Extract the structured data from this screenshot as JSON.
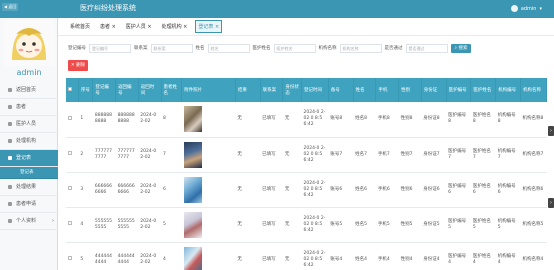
{
  "header": {
    "back_label": "◀ 返回",
    "title": "医疗纠纷处理系统",
    "admin_label": "admin"
  },
  "sidebar": {
    "username": "admin",
    "menu": [
      {
        "label": "返回首页"
      },
      {
        "label": "患者"
      },
      {
        "label": "医护人员"
      },
      {
        "label": "处理机构"
      },
      {
        "label": "登记表"
      },
      {
        "label": "处理结果"
      },
      {
        "label": "患者申请"
      },
      {
        "label": "个人资料"
      }
    ],
    "submenu_label": "登记表"
  },
  "tabs": [
    {
      "label": "系统首页"
    },
    {
      "label": "患者 ×"
    },
    {
      "label": "医护人员 ×"
    },
    {
      "label": "处理机构 ×"
    },
    {
      "label": "登记表 ×"
    }
  ],
  "filters": {
    "f1_label": "登记编号",
    "f1_placeholder": "登记编号",
    "f2_label": "联系案",
    "f2_placeholder": "联系案",
    "f3_label": "姓名",
    "f3_placeholder": "姓名",
    "f4_label": "医护姓名",
    "f4_placeholder": "医护姓名",
    "f5_label": "机构名称",
    "f5_placeholder": "机构名称",
    "f6_label": "是否通过",
    "f6_placeholder": "是否通过",
    "search_label": "搜索"
  },
  "delete_label": "删除",
  "table": {
    "headers": [
      "序号",
      "登记编号",
      "返回编号",
      "返回时间",
      "患者姓名",
      "附件照片",
      "结果",
      "联系案",
      "身份状态",
      "登记时间",
      "备号",
      "姓名",
      "手机",
      "性别",
      "身份证",
      "医护编号",
      "医护姓名",
      "机构编号",
      "机构名称"
    ],
    "rows": [
      {
        "idx": "1",
        "reg_no": "888888 8888",
        "ret_no": "888888 8888",
        "ret_time": "2024-0 2-02",
        "p_name": "8",
        "result": "无",
        "contact": "已填写",
        "status": "无",
        "reg_time": "2024-0 2-02 0 8:56:42",
        "num": "账号8",
        "name": "姓名8",
        "phone": "手机8",
        "gender": "性别8",
        "idcard": "身份证8",
        "d_no": "医护编号8",
        "d_name": "医护姓名8",
        "o_no": "机构编号8",
        "o_name": "机构名称8"
      },
      {
        "idx": "2",
        "reg_no": "777777 7777",
        "ret_no": "777777 7777",
        "ret_time": "2024-0 2-02",
        "p_name": "7",
        "result": "无",
        "contact": "已填写",
        "status": "无",
        "reg_time": "2024-0 2-02 0 8:56:42",
        "num": "账号7",
        "name": "姓名7",
        "phone": "手机7",
        "gender": "性别7",
        "idcard": "身份证7",
        "d_no": "医护编号7",
        "d_name": "医护姓名7",
        "o_no": "机构编号7",
        "o_name": "机构名称7"
      },
      {
        "idx": "3",
        "reg_no": "666666 6666",
        "ret_no": "666666 6666",
        "ret_time": "2024-0 2-02",
        "p_name": "6",
        "result": "无",
        "contact": "已填写",
        "status": "无",
        "reg_time": "2024-0 2-02 0 8:56:42",
        "num": "账号6",
        "name": "姓名6",
        "phone": "手机6",
        "gender": "性别6",
        "idcard": "身份证6",
        "d_no": "医护编号6",
        "d_name": "医护姓名6",
        "o_no": "机构编号6",
        "o_name": "机构名称6"
      },
      {
        "idx": "4",
        "reg_no": "555555 5555",
        "ret_no": "555555 5555",
        "ret_time": "2024-0 2-02",
        "p_name": "5",
        "result": "无",
        "contact": "已填写",
        "status": "无",
        "reg_time": "2024-0 2-02 0 8:56:42",
        "num": "账号5",
        "name": "姓名5",
        "phone": "手机5",
        "gender": "性别5",
        "idcard": "身份证5",
        "d_no": "医护编号5",
        "d_name": "医护姓名5",
        "o_no": "机构编号5",
        "o_name": "机构名称5"
      },
      {
        "idx": "5",
        "reg_no": "444444 4444",
        "ret_no": "444444 4444",
        "ret_time": "2024-0 2-02",
        "p_name": "4",
        "result": "无",
        "contact": "已填写",
        "status": "无",
        "reg_time": "2024-0 2-02 0 8:56:42",
        "num": "账号4",
        "name": "姓名4",
        "phone": "手机4",
        "gender": "性别4",
        "idcard": "身份证4",
        "d_no": "医护编号4",
        "d_name": "医护姓名4",
        "o_no": "机构编号4",
        "o_name": "机构名称4"
      }
    ]
  },
  "colors": {
    "primary": "#3a96b3",
    "header_row": "#3fa3bf",
    "danger": "#f04b4b"
  }
}
